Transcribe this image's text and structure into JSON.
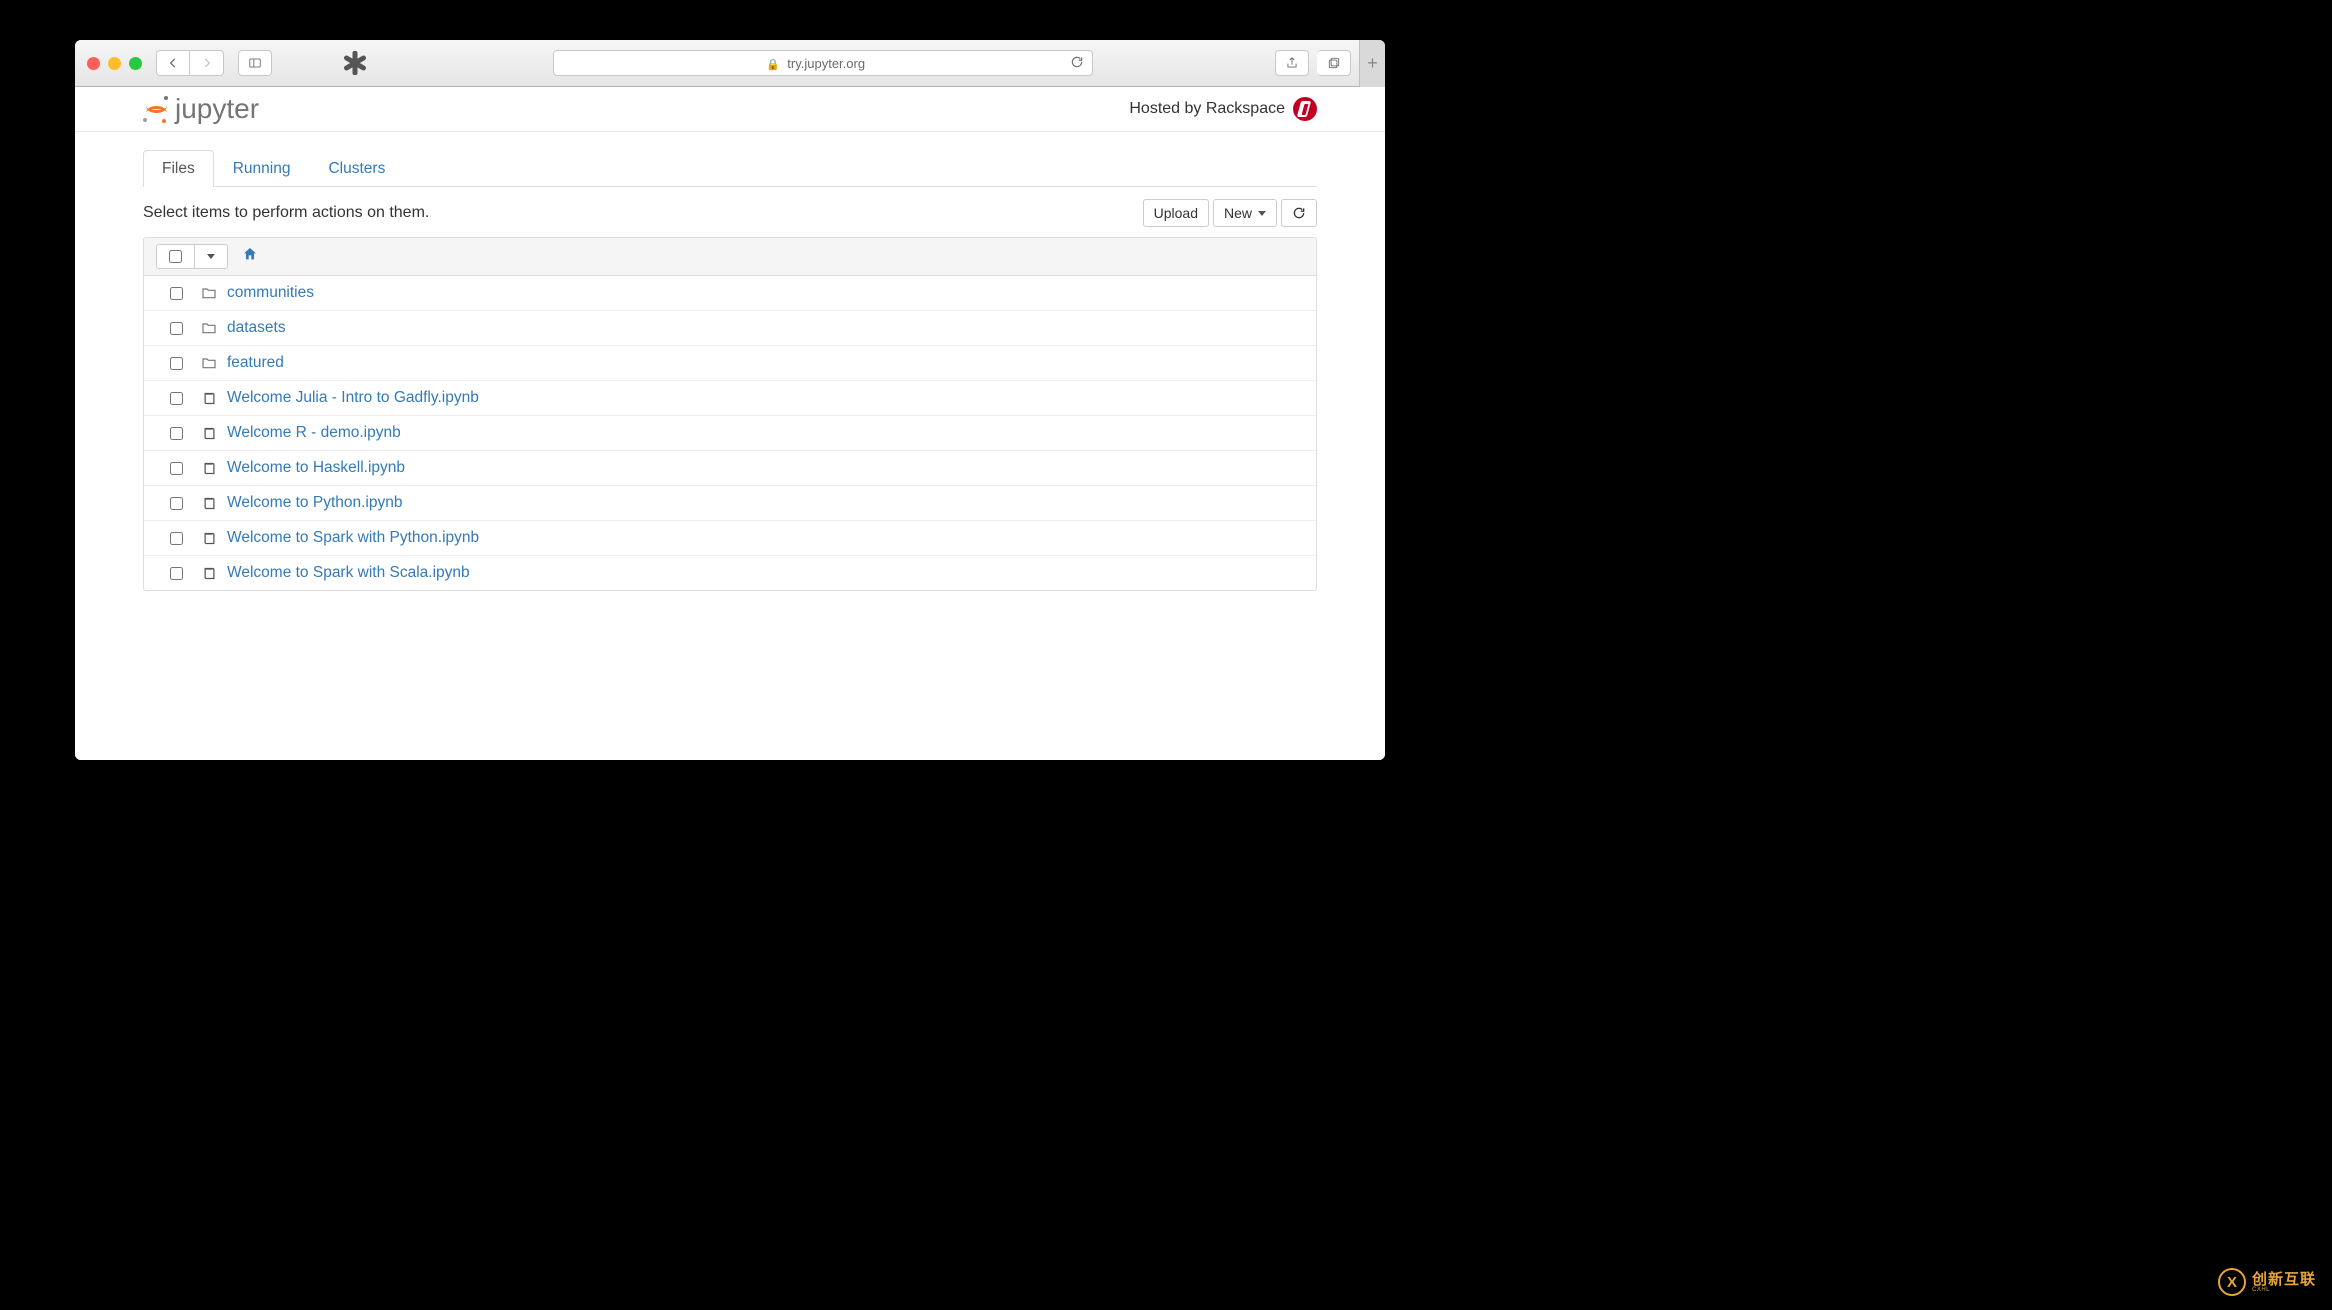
{
  "browser": {
    "url": "try.jupyter.org"
  },
  "header": {
    "logo_text": "jupyter",
    "hosting_text": "Hosted by Rackspace"
  },
  "tabs": {
    "files": "Files",
    "running": "Running",
    "clusters": "Clusters"
  },
  "toolbar": {
    "hint": "Select items to perform actions on them.",
    "upload": "Upload",
    "new": "New"
  },
  "files": [
    {
      "type": "folder",
      "name": "communities"
    },
    {
      "type": "folder",
      "name": "datasets"
    },
    {
      "type": "folder",
      "name": "featured"
    },
    {
      "type": "notebook",
      "name": "Welcome Julia - Intro to Gadfly.ipynb"
    },
    {
      "type": "notebook",
      "name": "Welcome R - demo.ipynb"
    },
    {
      "type": "notebook",
      "name": "Welcome to Haskell.ipynb"
    },
    {
      "type": "notebook",
      "name": "Welcome to Python.ipynb"
    },
    {
      "type": "notebook",
      "name": "Welcome to Spark with Python.ipynb"
    },
    {
      "type": "notebook",
      "name": "Welcome to Spark with Scala.ipynb"
    }
  ],
  "watermark": {
    "cn": "创新互联",
    "en": "CXHL"
  }
}
